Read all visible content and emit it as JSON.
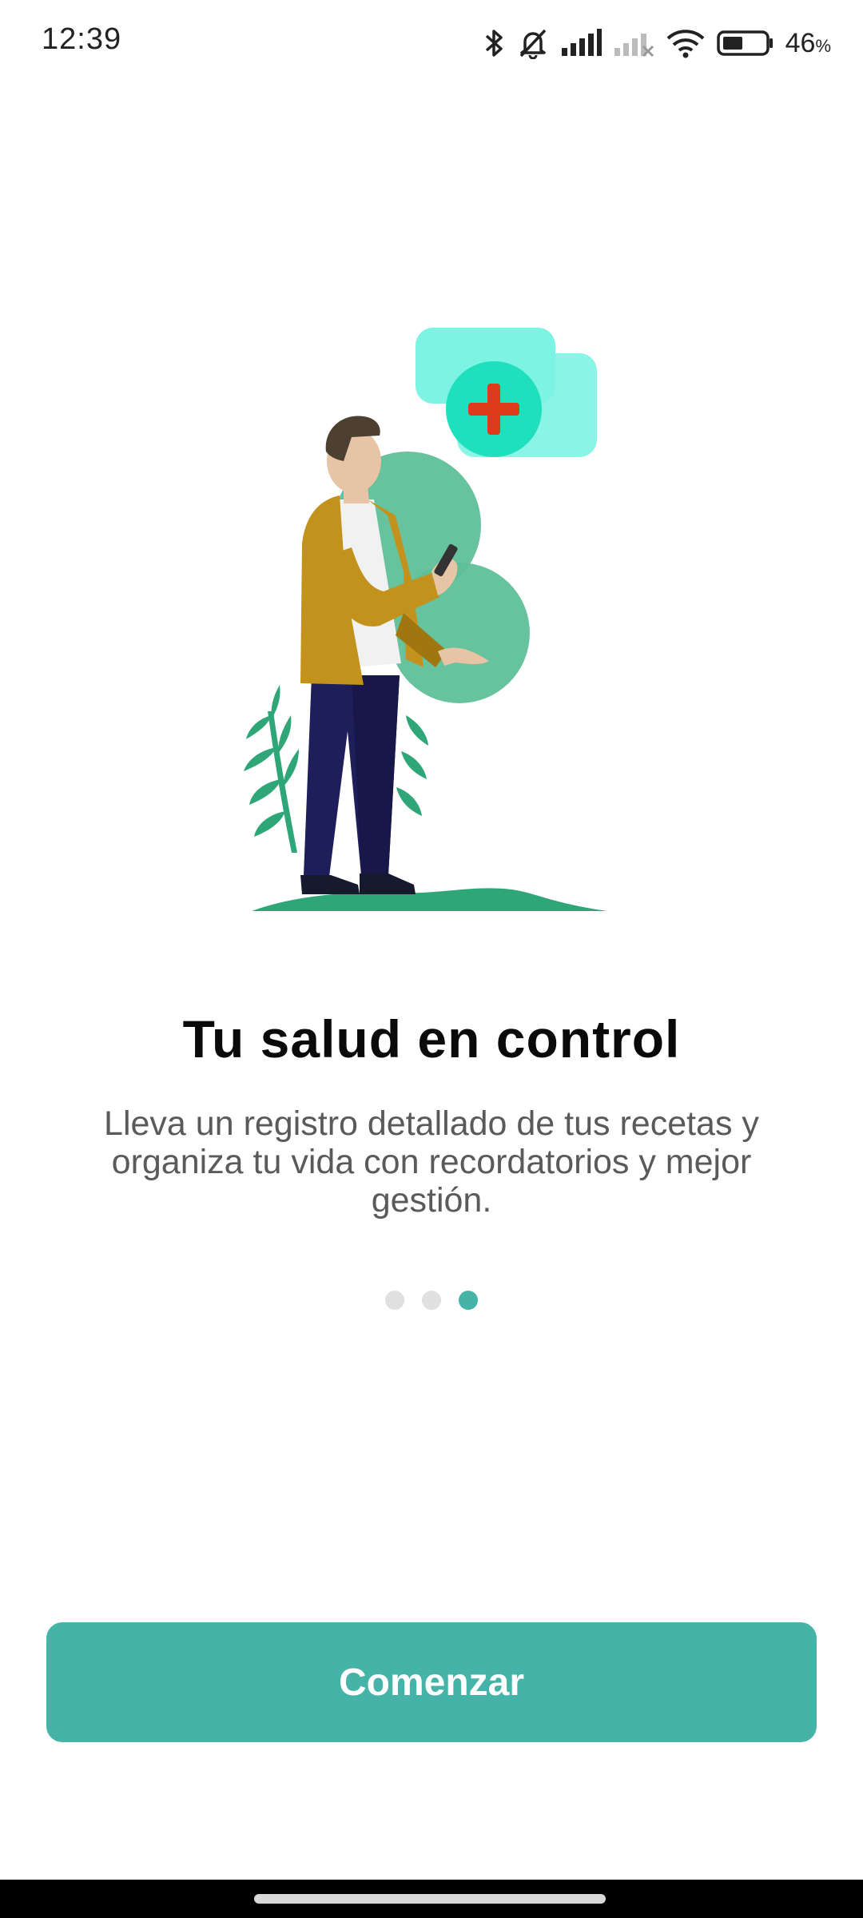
{
  "status_bar": {
    "time": "12:39",
    "battery_percent": "46",
    "battery_unit": "%",
    "icons": [
      "bluetooth-icon",
      "bell-off-icon",
      "signal-icon",
      "signal-off-icon",
      "wifi-icon",
      "battery-icon"
    ]
  },
  "onboarding": {
    "title": "Tu salud en control",
    "description": "Lleva un registro detallado de tus recetas y organiza tu vida con recordatorios y mejor gestión.",
    "pages": 3,
    "current_page": 3,
    "start_button_label": "Comenzar"
  },
  "colors": {
    "accent": "#45b3a7",
    "dot_inactive": "#e0e0e0",
    "title": "#0a0a0a",
    "text": "#5a5a5a"
  }
}
